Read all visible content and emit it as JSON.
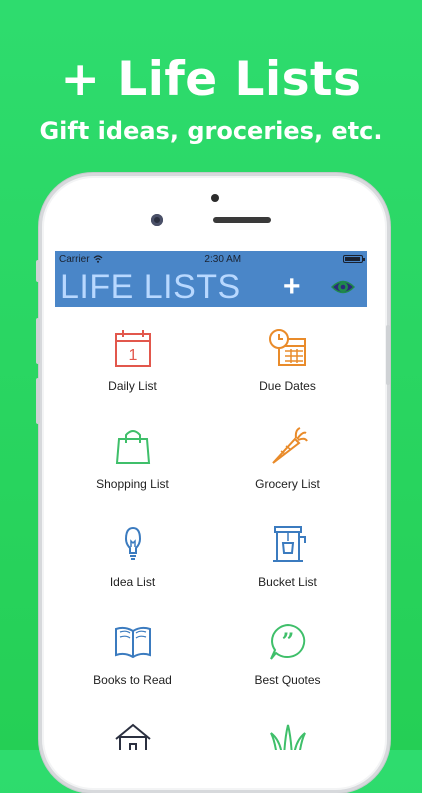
{
  "banner": {
    "headline": "+ Life Lists",
    "subline": "Gift ideas, groceries, etc."
  },
  "status": {
    "carrier": "Carrier",
    "time": "2:30 AM"
  },
  "navbar": {
    "title": "LIFE LISTS",
    "add_label": "+"
  },
  "colors": {
    "background": "#2bd862",
    "navbar": "#4a86c8",
    "title_text": "#b8d8ff",
    "red_icon": "#e2574c",
    "orange_icon": "#e98b2a",
    "green_icon": "#3fbf6a",
    "blue_icon": "#3b7bbf"
  },
  "lists": [
    {
      "label": "Daily List",
      "icon": "calendar-icon"
    },
    {
      "label": "Due Dates",
      "icon": "clock-calendar-icon"
    },
    {
      "label": "Shopping List",
      "icon": "shopping-bag-icon"
    },
    {
      "label": "Grocery List",
      "icon": "carrot-icon"
    },
    {
      "label": "Idea List",
      "icon": "lightbulb-icon"
    },
    {
      "label": "Bucket List",
      "icon": "bucket-well-icon"
    },
    {
      "label": "Books to Read",
      "icon": "open-book-icon"
    },
    {
      "label": "Best Quotes",
      "icon": "quote-bubble-icon"
    },
    {
      "label": "",
      "icon": "house-icon"
    },
    {
      "label": "",
      "icon": "grass-icon"
    }
  ],
  "calendar_day": "1"
}
